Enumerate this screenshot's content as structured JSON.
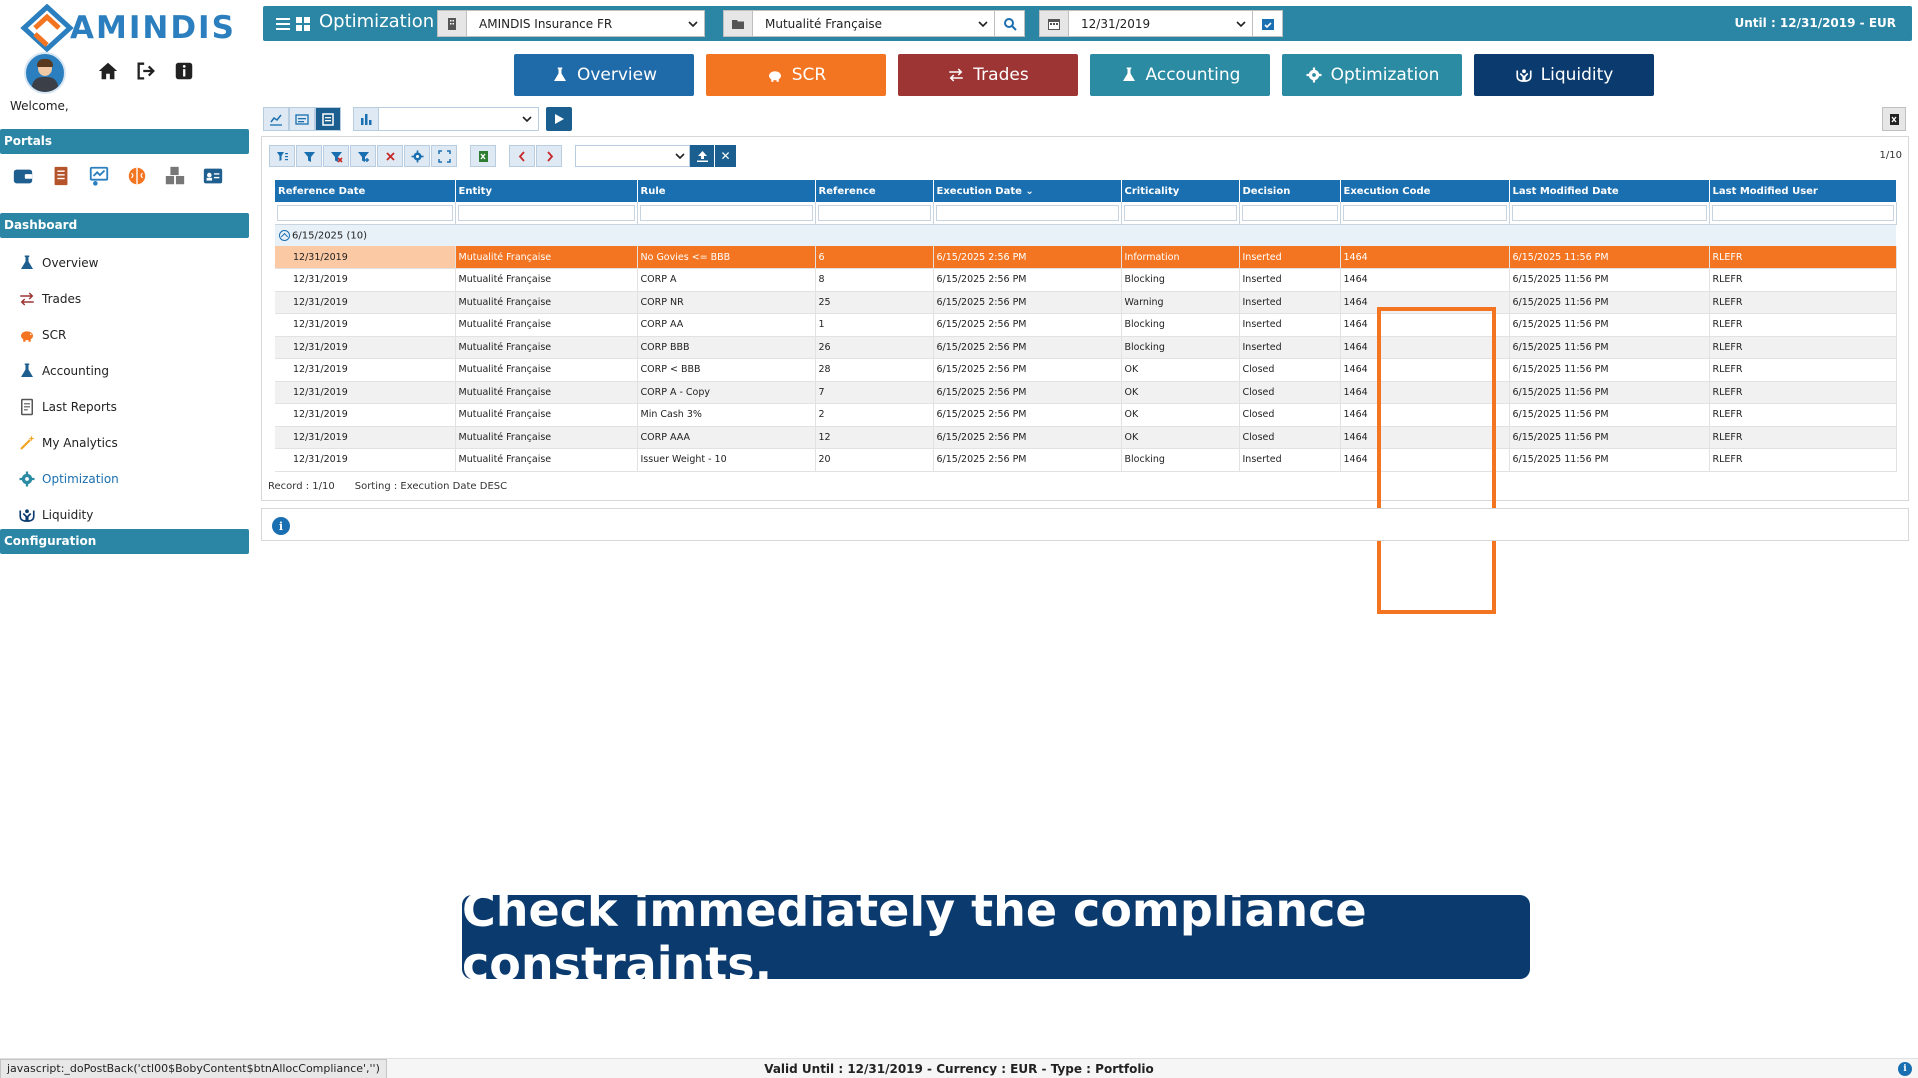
{
  "app": {
    "logo_text": "AMINDIS",
    "welcome": "Welcome,"
  },
  "sidebar": {
    "portals_header": "Portals",
    "dashboard_header": "Dashboard",
    "configuration_header": "Configuration",
    "portal_icons": [
      "wallet-icon",
      "ledger-icon",
      "analytics-icon",
      "brain-icon",
      "cubes-icon",
      "id-card-icon"
    ],
    "items": [
      {
        "label": "Overview",
        "icon": "flask-icon"
      },
      {
        "label": "Trades",
        "icon": "exchange-icon"
      },
      {
        "label": "SCR",
        "icon": "piggy-bank-icon"
      },
      {
        "label": "Accounting",
        "icon": "flask-icon"
      },
      {
        "label": "Last Reports",
        "icon": "report-icon"
      },
      {
        "label": "My Analytics",
        "icon": "magic-icon"
      },
      {
        "label": "Optimization",
        "icon": "gear-icon",
        "active": true
      },
      {
        "label": "Liquidity",
        "icon": "hands-icon"
      }
    ]
  },
  "topbar": {
    "title": "Optimization",
    "company_select": "AMINDIS Insurance FR",
    "entity_select": "Mutualité Française",
    "date_select": "12/31/2019",
    "until": "Until : 12/31/2019 - EUR"
  },
  "nav_tabs": [
    {
      "label": "Overview",
      "color": "#1f6aa8",
      "icon": "flask-icon"
    },
    {
      "label": "SCR",
      "color": "#f37521",
      "icon": "piggy-bank-icon"
    },
    {
      "label": "Trades",
      "color": "#9e3535",
      "icon": "exchange-icon"
    },
    {
      "label": "Accounting",
      "color": "#2a8ba3",
      "icon": "flask-icon"
    },
    {
      "label": "Optimization",
      "color": "#2a8ba3",
      "icon": "gear-icon"
    },
    {
      "label": "Liquidity",
      "color": "#0b3a6e",
      "icon": "hands-icon"
    }
  ],
  "grid": {
    "page_count": "1/10",
    "columns": [
      "Reference Date",
      "Entity",
      "Rule",
      "Reference",
      "Execution Date",
      "Criticality",
      "Decision",
      "Execution Code",
      "Last Modified Date",
      "Last Modified User"
    ],
    "sort_indicator": "⌄",
    "group_label": "6/15/2025 (10)",
    "rows": [
      [
        "12/31/2019",
        "Mutualité Française",
        "No Govies <= BBB",
        "6",
        "6/15/2025 2:56 PM",
        "Information",
        "Inserted",
        "1464",
        "6/15/2025 11:56 PM",
        "RLEFR"
      ],
      [
        "12/31/2019",
        "Mutualité Française",
        "CORP A",
        "8",
        "6/15/2025 2:56 PM",
        "Blocking",
        "Inserted",
        "1464",
        "6/15/2025 11:56 PM",
        "RLEFR"
      ],
      [
        "12/31/2019",
        "Mutualité Française",
        "CORP NR",
        "25",
        "6/15/2025 2:56 PM",
        "Warning",
        "Inserted",
        "1464",
        "6/15/2025 11:56 PM",
        "RLEFR"
      ],
      [
        "12/31/2019",
        "Mutualité Française",
        "CORP AA",
        "1",
        "6/15/2025 2:56 PM",
        "Blocking",
        "Inserted",
        "1464",
        "6/15/2025 11:56 PM",
        "RLEFR"
      ],
      [
        "12/31/2019",
        "Mutualité Française",
        "CORP BBB",
        "26",
        "6/15/2025 2:56 PM",
        "Blocking",
        "Inserted",
        "1464",
        "6/15/2025 11:56 PM",
        "RLEFR"
      ],
      [
        "12/31/2019",
        "Mutualité Française",
        "CORP < BBB",
        "28",
        "6/15/2025 2:56 PM",
        "OK",
        "Closed",
        "1464",
        "6/15/2025 11:56 PM",
        "RLEFR"
      ],
      [
        "12/31/2019",
        "Mutualité Française",
        "CORP A - Copy",
        "7",
        "6/15/2025 2:56 PM",
        "OK",
        "Closed",
        "1464",
        "6/15/2025 11:56 PM",
        "RLEFR"
      ],
      [
        "12/31/2019",
        "Mutualité Française",
        "Min Cash 3%",
        "2",
        "6/15/2025 2:56 PM",
        "OK",
        "Closed",
        "1464",
        "6/15/2025 11:56 PM",
        "RLEFR"
      ],
      [
        "12/31/2019",
        "Mutualité Française",
        "CORP AAA",
        "12",
        "6/15/2025 2:56 PM",
        "OK",
        "Closed",
        "1464",
        "6/15/2025 11:56 PM",
        "RLEFR"
      ],
      [
        "12/31/2019",
        "Mutualité Française",
        "Issuer Weight - 10",
        "20",
        "6/15/2025 2:56 PM",
        "Blocking",
        "Inserted",
        "1464",
        "6/15/2025 11:56 PM",
        "RLEFR"
      ]
    ],
    "footer_record": "Record : 1/10",
    "footer_sorting": "Sorting : Execution Date DESC"
  },
  "caption": "Check immediately the compliance constraints.",
  "statusbar": {
    "url": "javascript:_doPostBack('ctl00$BobyContent$btnAllocCompliance','')",
    "center": "Valid Until : 12/31/2019 - Currency : EUR - Type : Portfolio"
  },
  "colors": {
    "brand": "#2b7fbe",
    "teal_bar": "#2a86a4",
    "grid_header": "#1a6fb0",
    "selected_row": "#f37521",
    "highlight": "#f37521",
    "caption_bg": "#0b3a6e"
  }
}
